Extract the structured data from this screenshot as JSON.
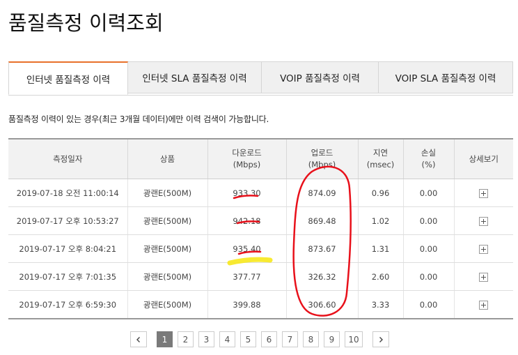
{
  "page": {
    "title": "품질측정 이력조회"
  },
  "tabs": [
    {
      "label": "인터넷 품질측정 이력",
      "active": true
    },
    {
      "label": "인터넷 SLA 품질측정 이력",
      "active": false
    },
    {
      "label": "VOIP 품질측정 이력",
      "active": false
    },
    {
      "label": "VOIP SLA 품질측정 이력",
      "active": false
    }
  ],
  "notice": "품질측정 이력이 있는 경우(최근 3개월 데이터)에만 이력 검색이 가능합니다.",
  "table": {
    "headers": [
      {
        "line1": "측정일자",
        "line2": ""
      },
      {
        "line1": "상품",
        "line2": ""
      },
      {
        "line1": "다운로드",
        "line2": "(Mbps)"
      },
      {
        "line1": "업로드",
        "line2": "(Mbps)"
      },
      {
        "line1": "지연",
        "line2": "(msec)"
      },
      {
        "line1": "손실",
        "line2": "(%)"
      },
      {
        "line1": "상세보기",
        "line2": ""
      }
    ],
    "rows": [
      {
        "date": "2019-07-18 오전 11:00:14",
        "product": "광랜E(500M)",
        "download": "933.30",
        "upload": "874.09",
        "latency": "0.96",
        "loss": "0.00"
      },
      {
        "date": "2019-07-17 오후 10:53:27",
        "product": "광랜E(500M)",
        "download": "942.18",
        "upload": "869.48",
        "latency": "1.02",
        "loss": "0.00"
      },
      {
        "date": "2019-07-17 오후 8:04:21",
        "product": "광랜E(500M)",
        "download": "935.40",
        "upload": "873.67",
        "latency": "1.31",
        "loss": "0.00"
      },
      {
        "date": "2019-07-17 오후 7:01:35",
        "product": "광랜E(500M)",
        "download": "377.77",
        "upload": "326.32",
        "latency": "2.60",
        "loss": "0.00"
      },
      {
        "date": "2019-07-17 오후 6:59:30",
        "product": "광랜E(500M)",
        "download": "399.88",
        "upload": "306.60",
        "latency": "3.33",
        "loss": "0.00"
      }
    ]
  },
  "pagination": {
    "pages": [
      "1",
      "2",
      "3",
      "4",
      "5",
      "6",
      "7",
      "8",
      "9",
      "10"
    ],
    "current": "1",
    "prev_icon": "chevron-left-icon",
    "next_icon": "chevron-right-icon"
  },
  "annotations": {
    "red": "#e8101a",
    "yellow": "#f7e81c"
  }
}
